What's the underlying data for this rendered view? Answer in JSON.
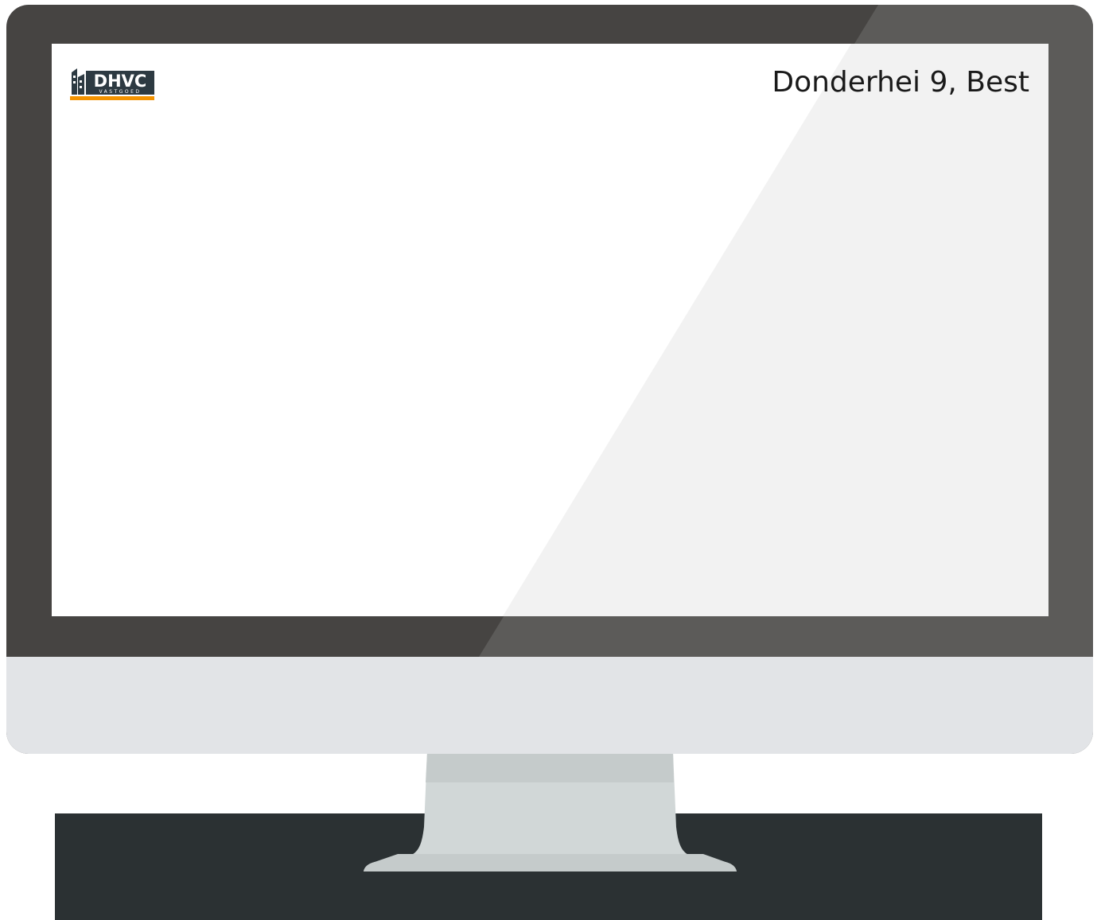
{
  "screen": {
    "logo": {
      "brand": "DHVC",
      "sub": "VASTGOED",
      "accent_color": "#f39200",
      "icon": "building-icon"
    },
    "address": "Donderhei 9, Best"
  },
  "colors": {
    "bezel": "#464442",
    "bezel_shine": "#5c5b59",
    "chin": "#e2e4e7",
    "stand": "#d1d7d7",
    "stand_dark": "#c5cbcb",
    "desk": "#2b3133",
    "screen": "#ffffff",
    "screen_shine": "#f2f2f2"
  }
}
